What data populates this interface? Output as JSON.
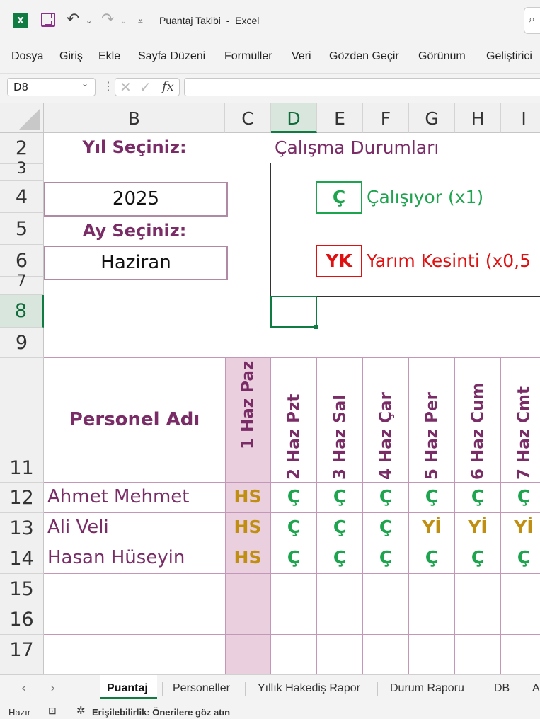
{
  "window": {
    "title": "Puantaj Takibi  -  Excel",
    "app_icon": "excel-icon"
  },
  "menu": [
    "Dosya",
    "Giriş",
    "Ekle",
    "Sayfa Düzeni",
    "Formüller",
    "Veri",
    "Gözden Geçir",
    "Görünüm",
    "Geliştirici"
  ],
  "formula_bar": {
    "name_box": "D8",
    "formula": "",
    "fx_label": "fx"
  },
  "columns": [
    "B",
    "C",
    "D",
    "E",
    "F",
    "G",
    "H",
    "I"
  ],
  "rows": [
    "2",
    "3",
    "4",
    "5",
    "6",
    "7",
    "8",
    "9",
    "11",
    "12",
    "13",
    "14",
    "15",
    "16",
    "17"
  ],
  "sheet": {
    "year_label": "Yıl Seçiniz:",
    "year_value": "2025",
    "month_label": "Ay Seçiniz:",
    "month_value": "Haziran",
    "legend_title": "Çalışma Durumları",
    "legend": [
      {
        "code": "Ç",
        "text": "Çalışıyor (x1)",
        "color": "#1ea34e"
      },
      {
        "code": "YK",
        "text": "Yarım Kesinti (x0,5",
        "color": "#e01010"
      }
    ],
    "name_header": "Personel Adı",
    "days": [
      "1 Haz Paz",
      "2 Haz Pzt",
      "3 Haz Sal",
      "4 Haz Çar",
      "5 Haz Per",
      "6 Haz Cum",
      "7 Haz Cmt"
    ],
    "personnel": [
      {
        "name": "Ahmet Mehmet",
        "values": [
          "HS",
          "Ç",
          "Ç",
          "Ç",
          "Ç",
          "Ç",
          "Ç"
        ]
      },
      {
        "name": "Ali Veli",
        "values": [
          "HS",
          "Ç",
          "Ç",
          "Ç",
          "Yİ",
          "Yİ",
          "Yİ"
        ]
      },
      {
        "name": "Hasan Hüseyin",
        "values": [
          "HS",
          "Ç",
          "Ç",
          "Ç",
          "Ç",
          "Ç",
          "Ç"
        ]
      }
    ]
  },
  "sheet_tabs": [
    "Puantaj",
    "Personeller",
    "Yıllık Hakediş Rapor",
    "Durum Raporu",
    "DB",
    "A"
  ],
  "status": {
    "ready": "Hazır",
    "accessibility": "Erişilebilirlik: Önerilere göz atın"
  },
  "colors": {
    "excel_green": "#107c41",
    "label_purple": "#7a2c67",
    "weekend_fill": "#ead0df",
    "present_green": "#1ea34e",
    "other_gold": "#c08f12"
  }
}
